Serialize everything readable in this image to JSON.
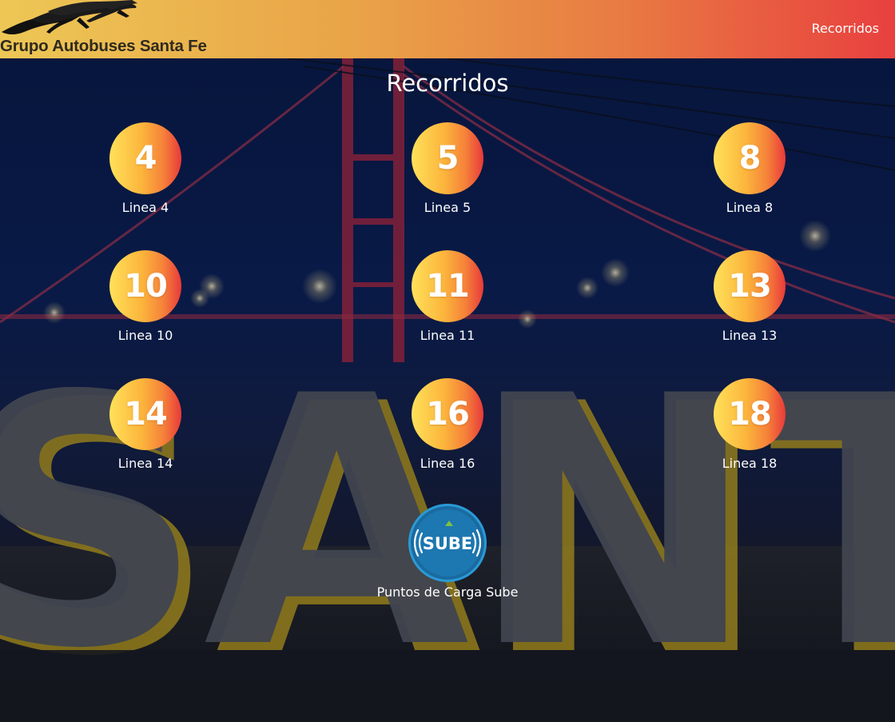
{
  "header": {
    "brand": "Grupo Autobuses Santa Fe",
    "nav_link": "Recorridos"
  },
  "page_title": "Recorridos",
  "lines": [
    {
      "number": "4",
      "label": "Linea 4"
    },
    {
      "number": "5",
      "label": "Linea 5"
    },
    {
      "number": "8",
      "label": "Linea 8"
    },
    {
      "number": "10",
      "label": "Linea 10"
    },
    {
      "number": "11",
      "label": "Linea 11"
    },
    {
      "number": "13",
      "label": "Linea 13"
    },
    {
      "number": "14",
      "label": "Linea 14"
    },
    {
      "number": "16",
      "label": "Linea 16"
    },
    {
      "number": "18",
      "label": "Linea 18"
    }
  ],
  "sube": {
    "logo_text": "SUBE",
    "label": "Puntos de Carga Sube"
  },
  "colors": {
    "header_start": "#edc755",
    "header_end": "#e8403f",
    "circle_start": "#ffe15a",
    "circle_end": "#e83a3a",
    "sube_blue": "#1d77b0"
  }
}
